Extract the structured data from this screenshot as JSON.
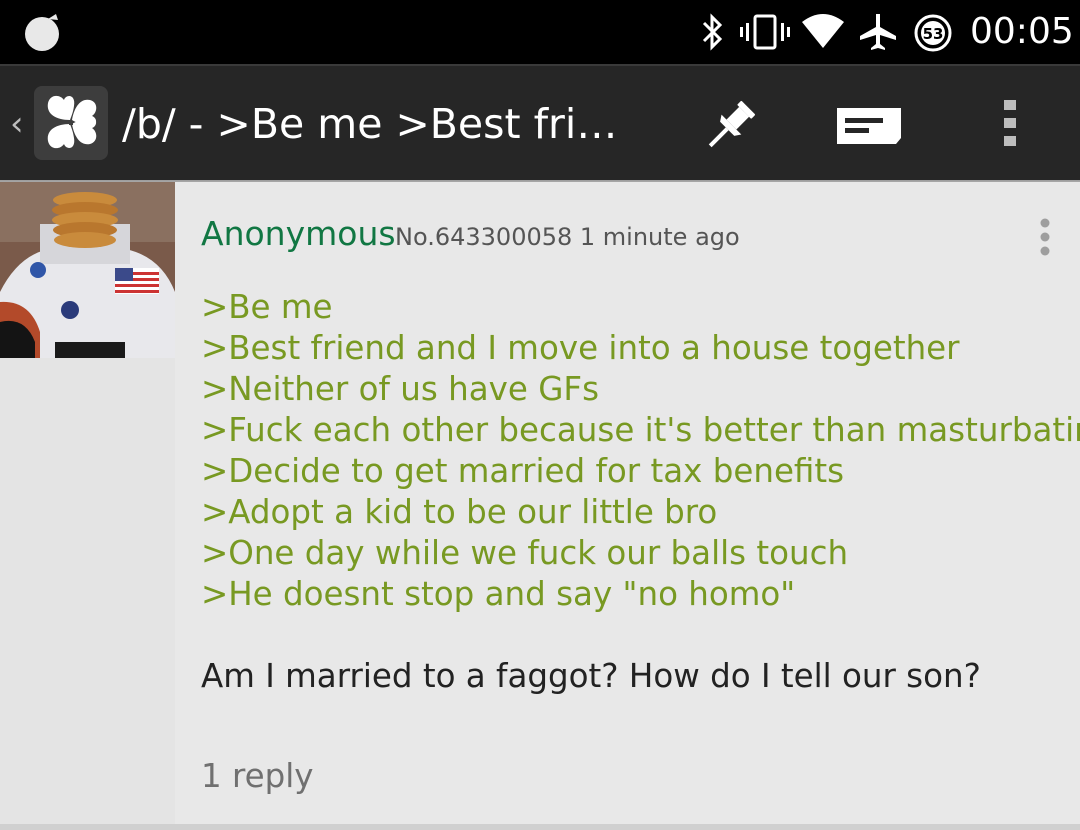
{
  "status_bar": {
    "battery_level": "53",
    "time": "00:05",
    "icons": [
      "notification-icon",
      "bluetooth-icon",
      "vibrate-icon",
      "wifi-icon",
      "airplane-icon",
      "battery-icon"
    ]
  },
  "action_bar": {
    "title": "/b/ - >Be me >Best frien...",
    "icons": [
      "back-arrow-icon",
      "clover-logo-icon",
      "pin-icon",
      "reply-icon",
      "overflow-menu-icon"
    ]
  },
  "post": {
    "name": "Anonymous",
    "meta": "No.643300058 1 minute ago",
    "greentext": [
      ">Be me",
      ">Best friend and I move into a house together",
      ">Neither of us have GFs",
      ">Fuck each other because it's better than masturbating",
      ">Decide to get married for tax benefits",
      ">Adopt a kid to be our little bro",
      ">One day while we fuck our balls touch",
      ">He doesnt stop and say \"no homo\""
    ],
    "body": "Am I married to a faggot? How do I tell our son?",
    "replies": "1 reply"
  },
  "colors": {
    "name_green": "#117743",
    "greentext": "#789922",
    "action_bar": "#262626",
    "post_bg": "#e8e8e8"
  }
}
